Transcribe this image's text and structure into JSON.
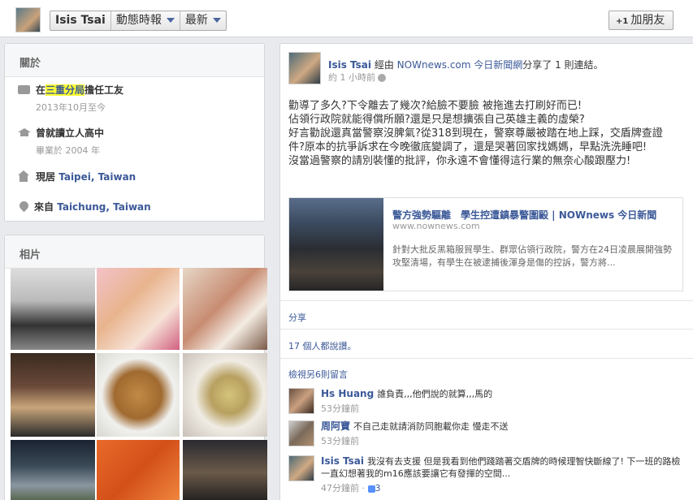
{
  "top": {
    "name": "Isis Tsai",
    "timeline_label": "動態時報",
    "sort_label": "最新",
    "add_friend_label": "加朋友"
  },
  "about": {
    "heading": "關於",
    "work": {
      "prefix": "在",
      "highlight": "三重分局",
      "suffix": "擔任工友",
      "date": "2013年10月至今"
    },
    "school": {
      "title": "曾就讀立人高中",
      "date": "畢業於 2004 年"
    },
    "lives": {
      "label": "現居",
      "place": "Taipei, Taiwan"
    },
    "from": {
      "label": "來自",
      "place": "Taichung, Taiwan"
    }
  },
  "photos": {
    "heading": "相片"
  },
  "post": {
    "author": "Isis Tsai",
    "via": "經由",
    "source": "NOWnews.com 今日新聞網",
    "action": "分享了 1 則連結。",
    "time": "約 1 小時前",
    "lines": [
      "勸導了多久?下令離去了幾次?給臉不要臉 被拖進去打刷好而已!",
      "佔領行政院就能得償所願?還是只是想擴張自己英雄主義的虛榮?",
      "好言勸說還真當警察沒脾氣?從318到現在，警察尊嚴被踏在地上踩，交盾牌查證件?原本的抗爭訴求在今晚徹底變調了，還是哭著回家找媽媽，早點洗洗睡吧!",
      "沒當過警察的請別裝懂的批評，你永遠不會懂得這行業的無奈心酸跟壓力!"
    ],
    "link": {
      "title": "警方強勢驅離　學生控遭鎮暴警圍毆 | NOWnews 今日新聞",
      "domain": "www.nownews.com",
      "desc": "針對大批反黑箱服貿學生、群眾佔領行政院，警方在24日凌晨展開強勢攻堅清場，有學生在被逮捕後渾身是傷的控訴，警方將..."
    },
    "share": "分享",
    "likes": "17 個人都說讚。",
    "view_more": "檢視另6則留言",
    "comments": [
      {
        "name": "Hs Huang",
        "text": "誰負責,,,他們說的就算,,,馬的",
        "time": "53分鐘前"
      },
      {
        "name": "周阿寶",
        "text": "不自己走就請消防同胞載你走 慢走不送",
        "time": "53分鐘前"
      },
      {
        "name": "Isis Tsai",
        "text": "我沒有去支援 但是我看到他們踐踏著交盾牌的時候理智快斷線了! 下一班的路檢一直幻想著我的m16應該要讓它有發揮的空間...",
        "time": "47分鐘前",
        "likes": "3"
      }
    ]
  },
  "colors": {
    "link": "#3b5998",
    "highlight": "#ffff33"
  }
}
